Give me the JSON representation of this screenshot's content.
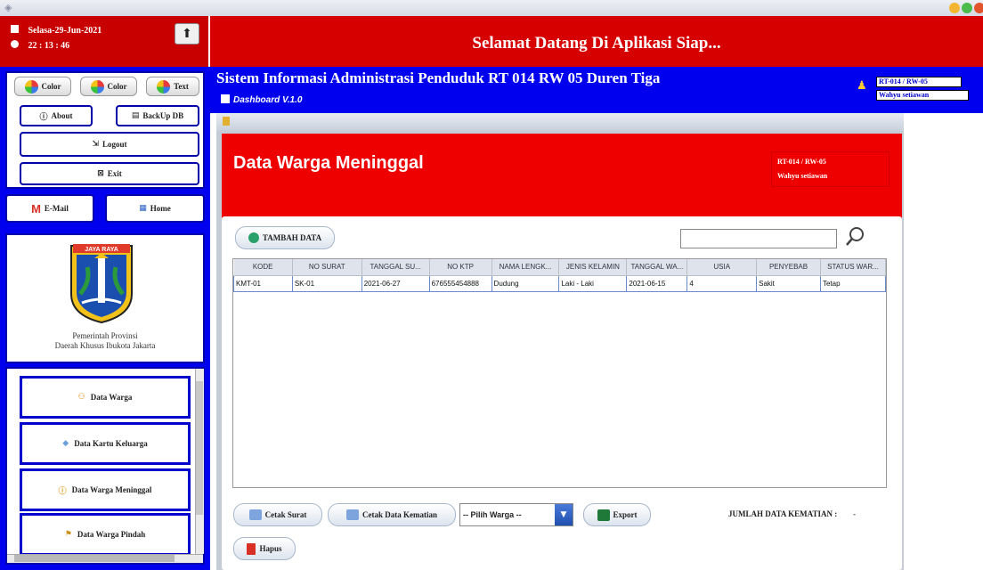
{
  "header": {
    "date": "Selasa-29-Jun-2021",
    "time": "22 : 13 : 46",
    "welcome": "Selamat Datang Di Aplikasi Siap..."
  },
  "system": {
    "title": "Sistem Informasi Administrasi Penduduk RT 014 RW 05 Duren Tiga",
    "version": "Dashboard V.1.0",
    "rt_rw": "RT-014 / RW-05",
    "user": "Wahyu setiawan"
  },
  "sidebar": {
    "color_btn_1": "Color",
    "color_btn_2": "Color",
    "text_btn": "Text",
    "about": "About",
    "backup": "BackUp DB",
    "logout": "Logout",
    "exit": "Exit",
    "email": "E-Mail",
    "home": "Home",
    "logo_seal_text": "JAYA RAYA",
    "logo_line1": "Pemerintah Provinsi",
    "logo_line2": "Daerah Khusus Ibukota Jakarta",
    "menu": [
      "Data Warga",
      "Data Kartu Keluarga",
      "Data Warga Meninggal",
      "Data Warga Pindah"
    ]
  },
  "form": {
    "title": "Data Warga Meninggal",
    "rt_rw": "RT-014 / RW-05",
    "user": "Wahyu setiawan",
    "add_button": "TAMBAH DATA",
    "search_value": ""
  },
  "table": {
    "columns": [
      "KODE",
      "NO SURAT",
      "TANGGAL SU...",
      "NO KTP",
      "NAMA LENGK...",
      "JENIS KELAMIN",
      "TANGGAL WA...",
      "USIA",
      "PENYEBAB",
      "STATUS WAR..."
    ],
    "rows": [
      [
        "KMT-01",
        "SK-01",
        "2021-06-27",
        "676555454888",
        "Dudung",
        "Laki - Laki",
        "2021-06-15",
        "4",
        "Sakit",
        "Tetap"
      ]
    ]
  },
  "actions": {
    "cetak_surat": "Cetak Surat",
    "cetak_kematian": "Cetak Data Kematian",
    "pilih_warga": "-- Pilih Warga --",
    "export": "Export",
    "hapus": "Hapus",
    "jumlah_label": "JUMLAH DATA KEMATIAN :",
    "jumlah_value": "-"
  },
  "colors": {
    "header_red": "#d60000",
    "panel_blue": "#0000ee",
    "banner_red": "#ee0000"
  }
}
